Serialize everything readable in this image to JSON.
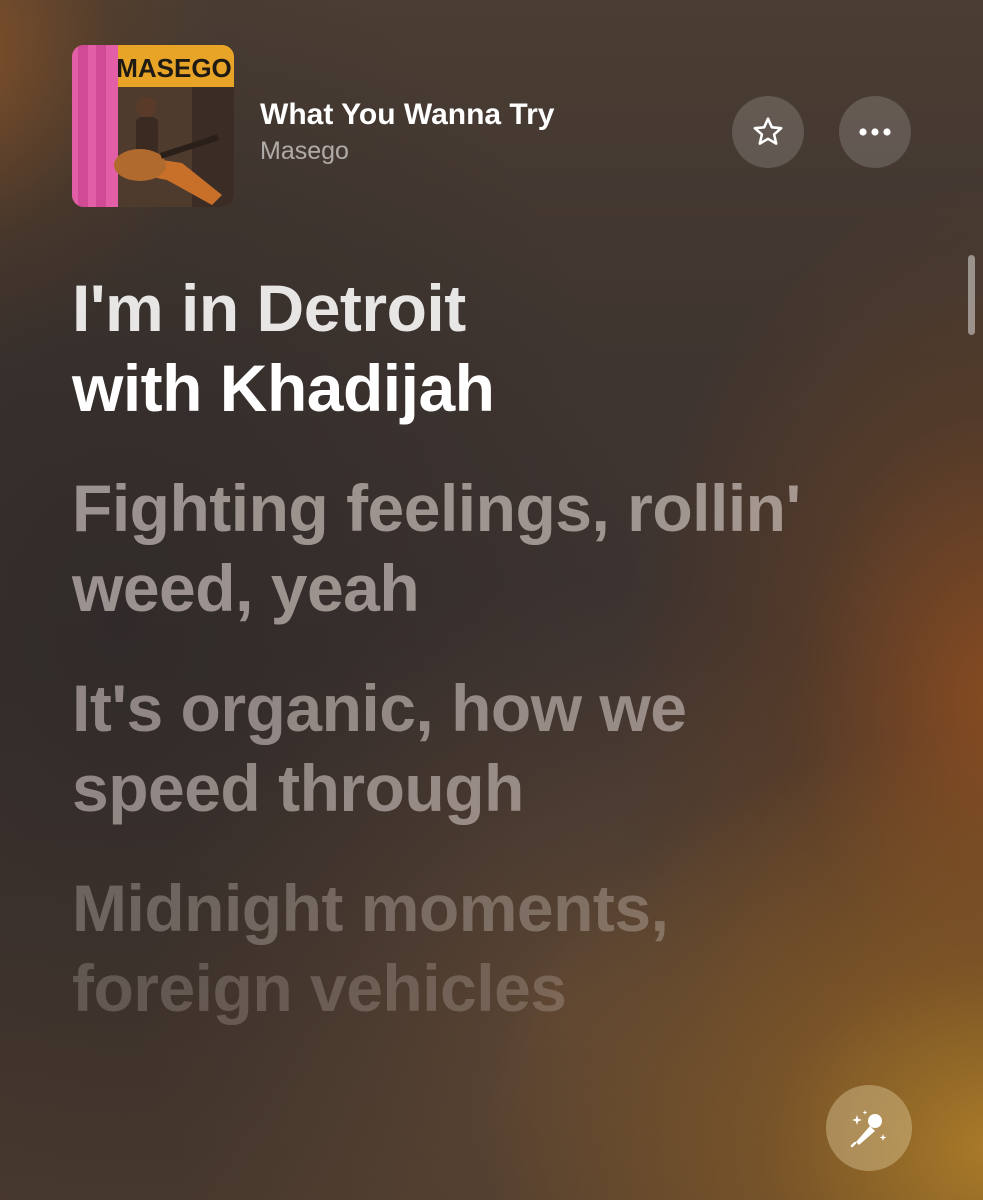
{
  "now_playing": {
    "album_art_text": "MASEGO",
    "title": "What You Wanna Try",
    "artist": "Masego"
  },
  "actions": {
    "favorite_icon": "star-icon",
    "more_icon": "ellipsis-icon",
    "sing_icon": "microphone-sparkles-icon"
  },
  "lyrics": [
    {
      "line1": "I'm in Detroit",
      "line2": "with Khadijah",
      "state": "active"
    },
    {
      "line1": "Fighting feelings, rollin'",
      "line2": "weed, yeah",
      "state": "upcoming"
    },
    {
      "line1": "It's organic, how we",
      "line2": "speed through",
      "state": "upcoming"
    },
    {
      "line1": "Midnight moments,",
      "line2": "foreign vehicles",
      "state": "upcoming"
    }
  ],
  "colors": {
    "accent_text": "#ffffff",
    "secondary_text": "#a39a93",
    "bg_warm": "#b08028"
  }
}
